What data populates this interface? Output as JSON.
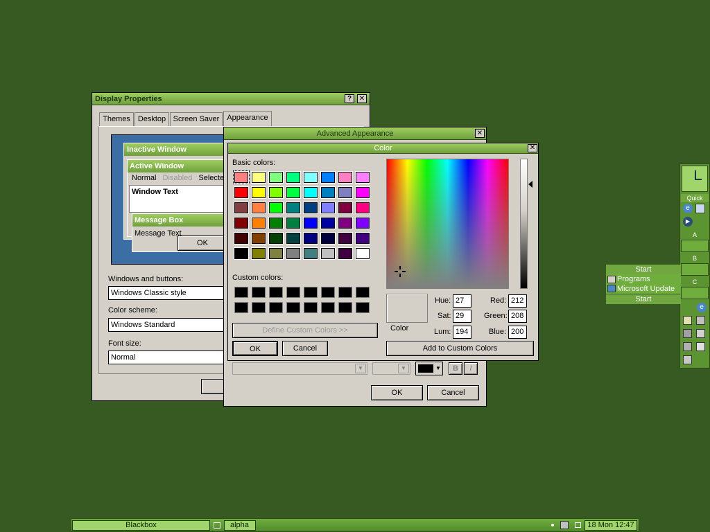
{
  "display_properties": {
    "title": "Display Properties",
    "help_btn": "?",
    "close_btn": "✕",
    "tabs": [
      "Themes",
      "Desktop",
      "Screen Saver",
      "Appearance"
    ],
    "preview": {
      "inactive_window": "Inactive Window",
      "active_window": "Active Window",
      "menu_normal": "Normal",
      "menu_disabled": "Disabled",
      "menu_selected": "Selecte",
      "window_text": "Window Text",
      "message_box": "Message Box",
      "message_text": "Message Text",
      "ok": "OK"
    },
    "windows_buttons_label": "Windows and buttons:",
    "windows_buttons_value": "Windows Classic style",
    "color_scheme_label": "Color scheme:",
    "color_scheme_value": "Windows Standard",
    "font_size_label": "Font size:",
    "font_size_value": "Normal"
  },
  "advanced_appearance": {
    "title": "Advanced Appearance",
    "close_btn": "✕",
    "bold_btn": "B",
    "italic_btn": "I",
    "ok": "OK",
    "cancel": "Cancel"
  },
  "color_dialog": {
    "title": "Color",
    "close_btn": "✕",
    "basic_label": "Basic colors:",
    "custom_label": "Custom colors:",
    "define_custom": "Define Custom Colors >>",
    "ok": "OK",
    "cancel": "Cancel",
    "color_solid_label": "Color",
    "hue_label": "Hue:",
    "hue": "27",
    "sat_label": "Sat:",
    "sat": "29",
    "lum_label": "Lum:",
    "lum": "194",
    "red_label": "Red:",
    "red": "212",
    "green_label": "Green:",
    "green": "208",
    "blue_label": "Blue:",
    "blue": "200",
    "add_custom": "Add to Custom Colors",
    "basic_colors": [
      "#ff8080",
      "#ffff80",
      "#80ff80",
      "#00ff80",
      "#80ffff",
      "#0080ff",
      "#ff80c0",
      "#ff80ff",
      "#ff0000",
      "#ffff00",
      "#80ff00",
      "#00ff40",
      "#00ffff",
      "#0080c0",
      "#8080c0",
      "#ff00ff",
      "#804040",
      "#ff8040",
      "#00ff00",
      "#008080",
      "#004080",
      "#8080ff",
      "#800040",
      "#ff0080",
      "#800000",
      "#ff8000",
      "#008000",
      "#008040",
      "#0000ff",
      "#0000a0",
      "#800080",
      "#8000ff",
      "#400000",
      "#804000",
      "#004000",
      "#004040",
      "#000080",
      "#000040",
      "#400040",
      "#400080",
      "#000000",
      "#808000",
      "#808040",
      "#808080",
      "#408080",
      "#c0c0c0",
      "#400040",
      "#ffffff"
    ]
  },
  "slit": {
    "quick_label": "Quick",
    "a_label": "A",
    "b_label": "B",
    "c_label": "C"
  },
  "menu": {
    "header": "Start",
    "programs": "Programs",
    "ms_update": "Microsoft Update",
    "footer": "Start"
  },
  "taskbar": {
    "workspace": "Blackbox",
    "task": "alpha",
    "clock": "18 Mon 12:47"
  },
  "colors": {
    "desktop": "#375a23",
    "accent": "#7cb848"
  }
}
